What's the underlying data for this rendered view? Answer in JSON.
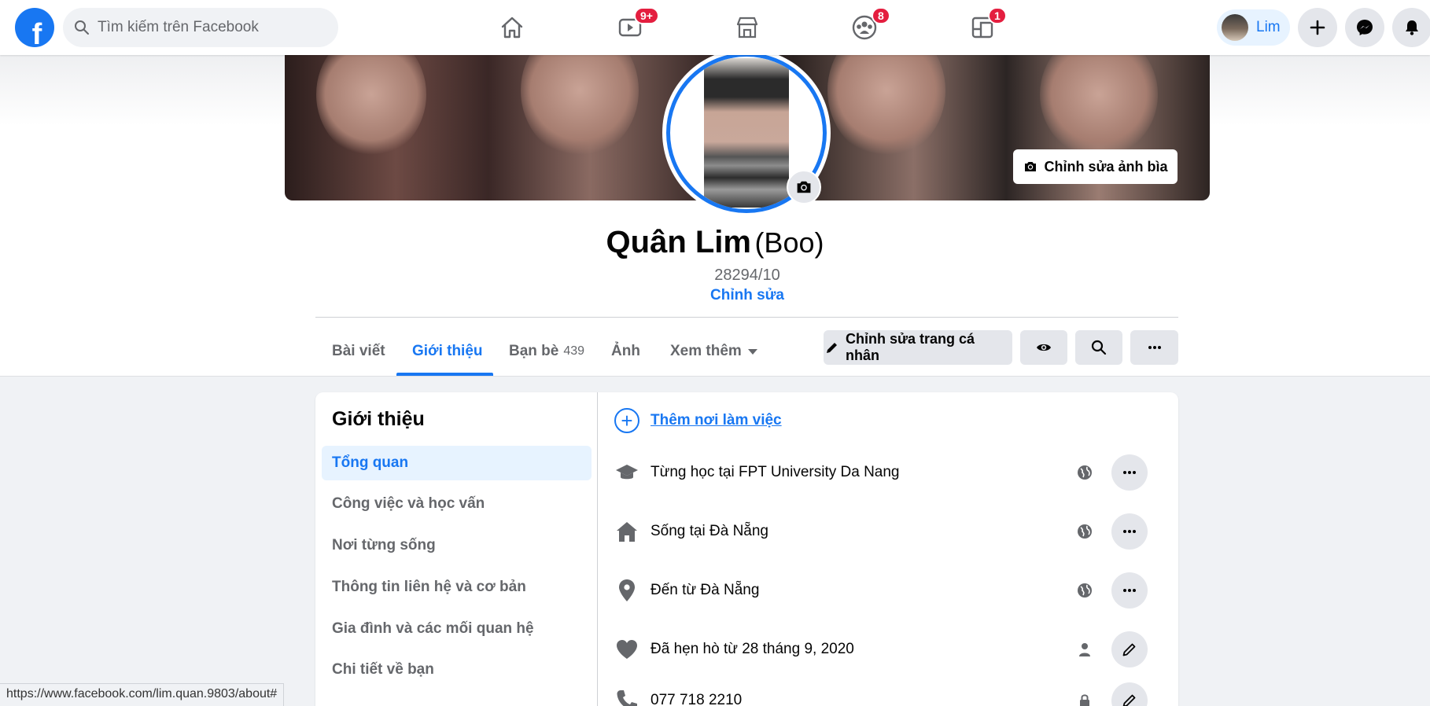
{
  "nav": {
    "logo": "f",
    "search_placeholder": "Tìm kiếm trên Facebook",
    "tabs": [
      {
        "name": "home",
        "icon": "home-icon",
        "badge": ""
      },
      {
        "name": "watch",
        "icon": "video-icon",
        "badge": "9+"
      },
      {
        "name": "marketplace",
        "icon": "store-icon",
        "badge": ""
      },
      {
        "name": "groups",
        "icon": "groups-icon",
        "badge": "8"
      },
      {
        "name": "gaming",
        "icon": "gaming-icon",
        "badge": "1"
      }
    ],
    "profile_name": "Lim"
  },
  "profile": {
    "name": "Quân Lim",
    "alt_name": "(Boo)",
    "bio": "28294/10",
    "bio_edit": "Chỉnh sửa",
    "cover_edit": "Chỉnh sửa ảnh bìa"
  },
  "tabs": [
    {
      "label": "Bài viết",
      "count": ""
    },
    {
      "label": "Giới thiệu",
      "count": ""
    },
    {
      "label": "Bạn bè",
      "count": "439"
    },
    {
      "label": "Ảnh",
      "count": ""
    },
    {
      "label": "Xem thêm",
      "count": ""
    }
  ],
  "actions": {
    "edit_profile": "Chỉnh sửa trang cá nhân"
  },
  "about": {
    "title": "Giới thiệu",
    "sections": [
      "Tổng quan",
      "Công việc và học vấn",
      "Nơi từng sống",
      "Thông tin liên hệ và cơ bản",
      "Gia đình và các mối quan hệ",
      "Chi tiết về bạn"
    ],
    "add_work": "Thêm nơi làm việc",
    "rows": [
      {
        "text": "Từng học tại FPT University Da Nang",
        "icon": "graduation-cap-icon",
        "privacy": "globe-icon",
        "action": "more-icon"
      },
      {
        "text": "Sống tại Đà Nẵng",
        "icon": "house-icon",
        "privacy": "globe-icon",
        "action": "more-icon"
      },
      {
        "text": "Đến từ Đà Nẵng",
        "icon": "location-pin-icon",
        "privacy": "globe-icon",
        "action": "more-icon"
      },
      {
        "text": "Đã hẹn hò từ 28 tháng 9, 2020",
        "icon": "heart-icon",
        "privacy": "person-icon",
        "action": "pencil-icon"
      },
      {
        "text": "077 718 2210",
        "icon": "phone-icon",
        "privacy": "lock-icon",
        "action": "pencil-icon"
      }
    ]
  },
  "status_url": "https://www.facebook.com/lim.quan.9803/about#",
  "colors": {
    "accent": "#1877f2",
    "badge": "#e41e3f",
    "secondary_bg": "#e4e6eb"
  }
}
